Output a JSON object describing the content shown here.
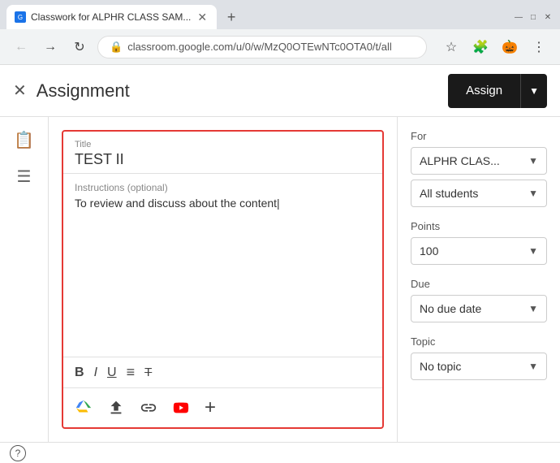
{
  "browser": {
    "tab_title": "Classwork for ALPHR CLASS SAM...",
    "url": "classroom.google.com/u/0/w/MzQ0OTEwNTc0OTA0/t/all",
    "new_tab_label": "+"
  },
  "header": {
    "title": "Assignment",
    "assign_button": "Assign"
  },
  "form": {
    "title_label": "Title",
    "title_value": "TEST II",
    "instructions_label": "Instructions (optional)",
    "instructions_value": "To review and discuss about the content|"
  },
  "toolbar": {
    "bold": "B",
    "italic": "I",
    "underline": "U",
    "list": "≡",
    "strikethrough": "T̶"
  },
  "sidebar": {
    "for_label": "For",
    "class_value": "ALPHR CLAS...",
    "students_label": "All students",
    "points_label": "Points",
    "points_value": "100",
    "due_label": "Due",
    "due_value": "No due date",
    "topic_label": "Topic",
    "topic_value": "No topic"
  },
  "footer": {
    "help_label": "?"
  }
}
